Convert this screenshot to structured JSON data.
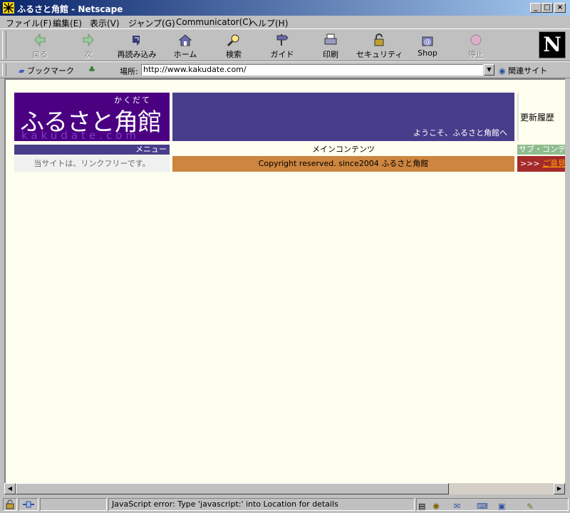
{
  "window": {
    "title": "ふるさと角館 - Netscape",
    "minimize": "_",
    "maximize": "□",
    "close": "×"
  },
  "menubar": [
    "ファイル(F)",
    "編集(E)",
    "表示(V)",
    "ジャンプ(G)",
    "Communicator(C)",
    "ヘルプ(H)"
  ],
  "toolbar": {
    "back": "戻る",
    "forward": "次",
    "reload": "再読み込み",
    "home": "ホーム",
    "search": "検索",
    "guide": "ガイド",
    "print": "印刷",
    "security": "セキュリティ",
    "shop": "Shop",
    "stop": "停止",
    "netscape_logo": "N"
  },
  "location": {
    "bookmarks": "ブックマーク",
    "label": "場所:",
    "url": "http://www.kakudate.com/",
    "related": "関連サイト"
  },
  "page": {
    "logo_kana": "かくだて",
    "logo_title": "ふるさと角館",
    "logo_sub": "kakudate.com",
    "welcome": "ようこそ、ふるさと角館へ",
    "update_history": "更新履歴",
    "menu_header": "メニュー",
    "main_header": "メインコンテンツ",
    "sub_header": "サブ・コンテンツ",
    "link_free": "当サイトは、リンクフリーです。",
    "copyright": "Copyright reserved. since2004 ふるさと角館",
    "opinion_prefix": ">>>",
    "opinion_link": "ご意見・ご感想"
  },
  "status": {
    "message": "JavaScript error: Type 'javascript:' into Location for details"
  },
  "colors": {
    "logo_bg": "#4b0082",
    "banner_bg": "#483d8b",
    "page_bg": "#fffff0",
    "copyright_bg": "#cd853f",
    "opinion_bg": "#a52a2a",
    "sub_header_bg": "#8fbc8f"
  }
}
